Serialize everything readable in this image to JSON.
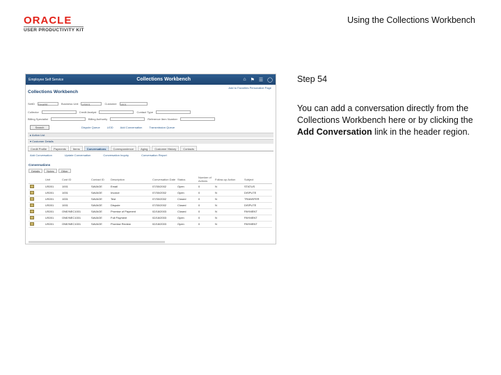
{
  "header": {
    "logo_brand": "ORACLE",
    "logo_sub": "USER PRODUCTIVITY KIT",
    "doc_title": "Using the Collections Workbench"
  },
  "screenshot": {
    "back_label": "Employee Self Service",
    "title": "Collections Workbench",
    "page_title": "Collections Workbench",
    "links": "Add to Favorites  Personalize Page",
    "criteria": [
      {
        "label": "SetID",
        "value": "SHARE"
      },
      {
        "label": "Business Unit",
        "value": "US001"
      },
      {
        "label": "Customer",
        "value": "1001"
      },
      {
        "label": "Contact Type",
        "value": ""
      },
      {
        "label": "Billing Specialist",
        "value": ""
      },
      {
        "label": "Collector",
        "value": ""
      },
      {
        "label": "Credit Analyst",
        "value": ""
      },
      {
        "label": "Billing Authority",
        "value": ""
      },
      {
        "label": "Reference Item Number",
        "value": ""
      }
    ],
    "search_button": "Search",
    "quick_links": [
      "Dispute Queue",
      "UOD",
      "Add Conversation",
      "Transmission Queue"
    ],
    "sections": [
      "Action List",
      "Customer Details"
    ],
    "tabs": [
      "Credit Profile",
      "Payments",
      "Items",
      "Conversations",
      "Correspondence",
      "Aging",
      "Customer History",
      "Contacts"
    ],
    "active_tab": "Conversations",
    "sublinks": [
      "Add Conversation",
      "Update Conversation",
      "Conversation Inquiry",
      "Conversation Report"
    ],
    "grid_title": "Conversations",
    "grid_tabs": [
      "Details",
      "Notes",
      "Other"
    ],
    "columns": [
      "",
      "Unit",
      "Cust ID",
      "Contact ID",
      "Description",
      "Conversation Date",
      "Status",
      "Number of Actions",
      "Follow-up Action",
      "Subject"
    ],
    "rows": [
      [
        "",
        "US001",
        "1001",
        "SAVAGE",
        "Email",
        "07/30/2002",
        "Open",
        "0",
        "N",
        "STATUS"
      ],
      [
        "",
        "US001",
        "1001",
        "SAVAGE",
        "Invoice",
        "07/30/2002",
        "Open",
        "0",
        "N",
        "DISPUTE"
      ],
      [
        "",
        "US001",
        "1001",
        "SAVAGE",
        "Test",
        "07/30/2002",
        "Closed",
        "0",
        "N",
        "TRANSFER"
      ],
      [
        "",
        "US001",
        "1001",
        "SAVAGE",
        "Dispute",
        "07/30/2002",
        "Closed",
        "0",
        "N",
        "DISPUTE"
      ],
      [
        "",
        "US001",
        "ONE/NEC1001",
        "SAVAGE",
        "Promise of Payment",
        "02/18/2003",
        "Closed",
        "0",
        "N",
        "PAYMENT"
      ],
      [
        "",
        "US001",
        "ONE/NEC1001",
        "SAVAGE",
        "Full Payment",
        "02/18/2003",
        "Open",
        "0",
        "N",
        "PAYMENT"
      ],
      [
        "",
        "US001",
        "ONE/NEC1001",
        "SAVAGE",
        "Promise Review",
        "02/18/2003",
        "Open",
        "0",
        "N",
        "PAYMENT"
      ]
    ]
  },
  "step": {
    "label": "Step 54",
    "body_pre": "You can add a conversation directly from the Collections Workbench here or by clicking the ",
    "body_bold": "Add Conversation",
    "body_post": " link in the header region."
  }
}
